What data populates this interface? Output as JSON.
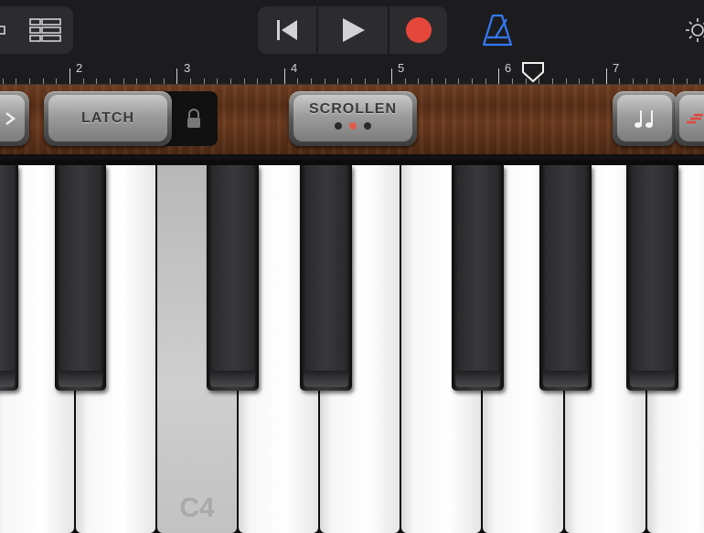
{
  "transport": {
    "rewind_icon": "skip-back-icon",
    "play_icon": "play-icon",
    "record_icon": "record-icon",
    "record_color": "#e5483b",
    "metronome_icon": "metronome-icon",
    "metronome_color": "#3478f6"
  },
  "ruler": {
    "bars": [
      "2",
      "3",
      "4",
      "5",
      "6",
      "7"
    ],
    "playhead_bar": "6"
  },
  "controls": {
    "latch_label": "LATCH",
    "scroll_label": "SCROLLEN",
    "scroll_dots": [
      "off",
      "on",
      "off"
    ],
    "scroll_dot_on_color": "#e25b4a"
  },
  "keyboard": {
    "pressed_key_label": "C4"
  }
}
